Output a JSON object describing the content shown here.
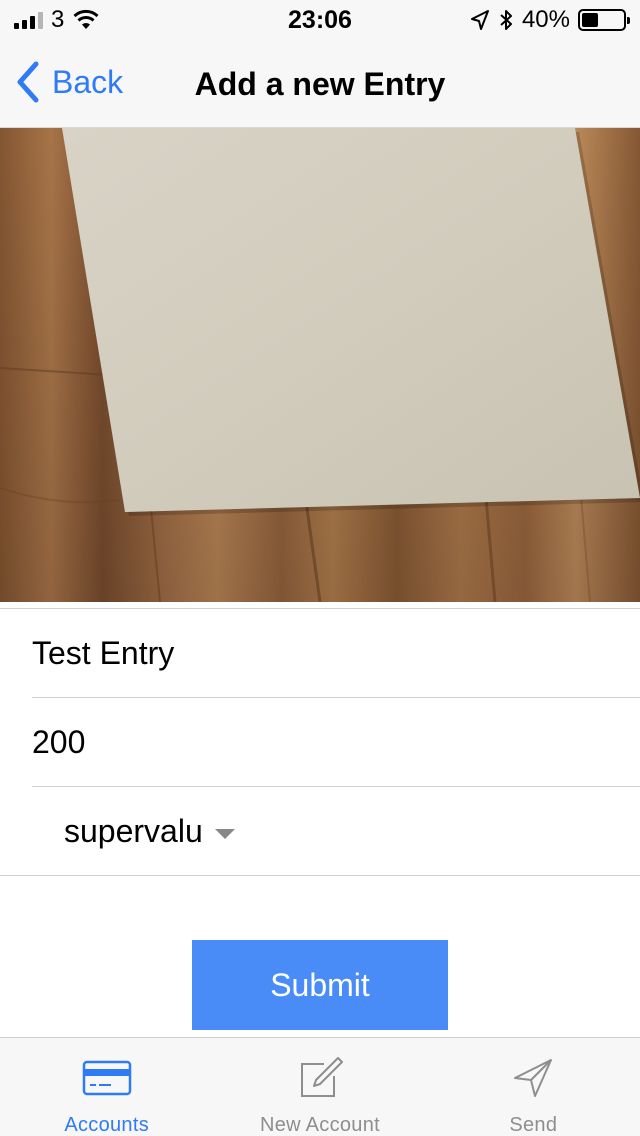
{
  "status_bar": {
    "carrier": "3",
    "time": "23:06",
    "battery_percent": "40%",
    "battery_level": 0.4,
    "icons": [
      "signal-icon",
      "wifi-icon",
      "location-icon",
      "bluetooth-icon",
      "battery-icon"
    ]
  },
  "nav": {
    "back_label": "Back",
    "title": "Add a new Entry"
  },
  "photo": {
    "subject": "paper-on-wood-photo"
  },
  "form": {
    "name_value": "Test Entry",
    "amount_value": "200",
    "account_selected": "supervalu"
  },
  "submit_label": "Submit",
  "tabs": [
    {
      "label": "Accounts",
      "icon": "credit-card-icon",
      "active": true
    },
    {
      "label": "New Account",
      "icon": "compose-icon",
      "active": false
    },
    {
      "label": "Send",
      "icon": "send-icon",
      "active": false
    }
  ],
  "colors": {
    "accent": "#2f7bf5",
    "button": "#4a8cf7",
    "inactive": "#8e8e8e"
  }
}
